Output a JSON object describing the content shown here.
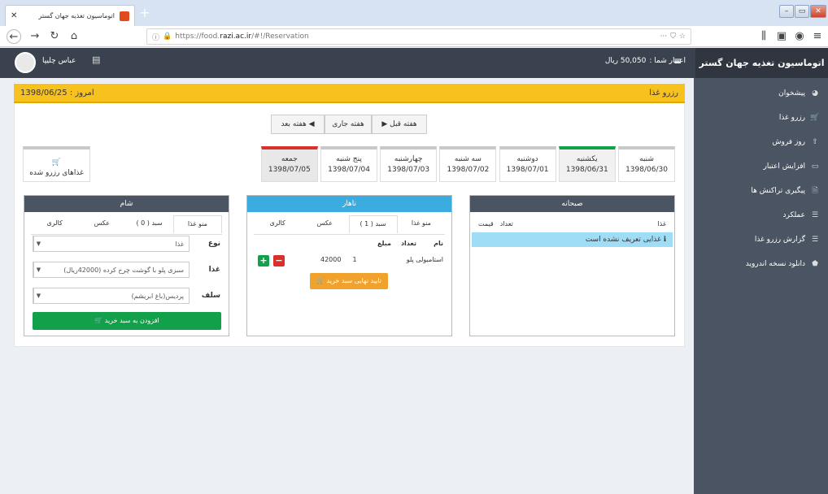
{
  "browser": {
    "tab_title": "اتوماسیون تغذیه جهان گستر",
    "url_prefix": "https://food.",
    "url_domain": "razi.ac.ir",
    "url_path": "/#!/Reservation",
    "url_menu": "···"
  },
  "header": {
    "brand": "اتوماسیون تغذیه جهان گستر",
    "credit_label": "اعتبار شما :",
    "credit_value": "50,050 ریال",
    "user_name": "عباس چلیپا"
  },
  "sidebar": {
    "items": [
      {
        "label": "پیشخوان",
        "icon": "dashboard-icon"
      },
      {
        "label": "رزرو غذا",
        "icon": "cart-icon"
      },
      {
        "label": "روز فروش",
        "icon": "upload-icon"
      },
      {
        "label": "افزایش اعتبار",
        "icon": "credit-card-icon"
      },
      {
        "label": "پیگیری تراکنش ها",
        "icon": "file-icon"
      },
      {
        "label": "عملکرد",
        "icon": "list-icon"
      },
      {
        "label": "گزارش رزرو غذا",
        "icon": "report-icon"
      },
      {
        "label": "دانلود نسخه اندروید",
        "icon": "android-icon"
      }
    ]
  },
  "panel": {
    "title": "رزرو غذا",
    "today": "امروز : 1398/06/25",
    "week_prev": "هفته قبل",
    "week_current": "هفته جاری",
    "week_next": "هفته بعد",
    "reserved_foods": "غذاهای رزرو شده",
    "days": [
      {
        "name": "شنبه",
        "date": "1398/06/30",
        "color": "#c8c8c8",
        "bg": "#fff"
      },
      {
        "name": "یکشنبه",
        "date": "1398/06/31",
        "color": "#12a14a",
        "bg": "#f1f1f1"
      },
      {
        "name": "دوشنبه",
        "date": "1398/07/01",
        "color": "#c8c8c8",
        "bg": "#fff"
      },
      {
        "name": "سه شنبه",
        "date": "1398/07/02",
        "color": "#c8c8c8",
        "bg": "#fff"
      },
      {
        "name": "چهارشنبه",
        "date": "1398/07/03",
        "color": "#c8c8c8",
        "bg": "#fff"
      },
      {
        "name": "پنج شنبه",
        "date": "1398/07/04",
        "color": "#c8c8c8",
        "bg": "#fff"
      },
      {
        "name": "جمعه",
        "date": "1398/07/05",
        "color": "#d9302a",
        "bg": "#e8e8e8"
      }
    ]
  },
  "breakfast": {
    "title": "صبحانه",
    "col_food": "غذا",
    "col_count": "تعداد",
    "col_price": "قیمت",
    "empty_msg": "غذایی تعریف نشده است"
  },
  "lunch": {
    "title": "ناهار",
    "tabs": [
      "منو غذا",
      "سبد ( 1 )",
      "عکس",
      "کالری"
    ],
    "col_name": "نام",
    "col_count": "تعداد",
    "col_amount": "مبلغ",
    "item_name": "استامبولی پلو",
    "item_count": "1",
    "item_amount": "42000",
    "confirm": "تایید نهایی سبد خرید"
  },
  "dinner": {
    "title": "شام",
    "tabs": [
      "منو غذا",
      "سبد ( 0 )",
      "عکس",
      "کالری"
    ],
    "type_label": "نوع",
    "type_value": "غذا",
    "food_label": "غذا",
    "food_value": "سبزی پلو با گوشت چرخ کرده (42000ریال)",
    "hall_label": "سلف",
    "hall_value": "پردیس(باغ ابریشم)",
    "add_btn": "افزودن به سبد خرید"
  },
  "colors": {
    "header_bar": "#f8c21e",
    "lunch_head": "#3aace0",
    "dark_head": "#4a5462",
    "green": "#12a14a",
    "orange": "#f0a22c"
  }
}
